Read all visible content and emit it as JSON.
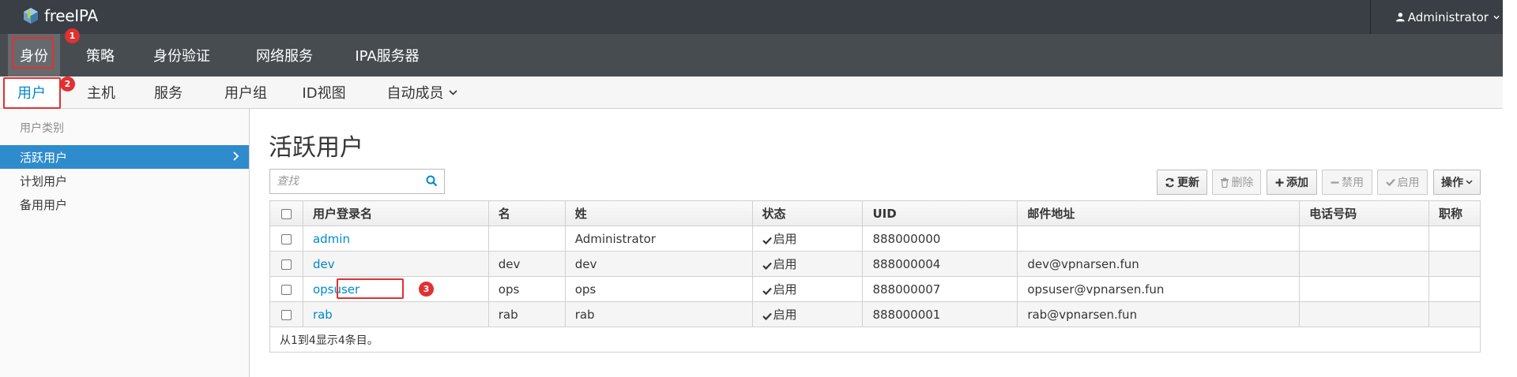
{
  "app": {
    "brand": "freeIPA",
    "user": "Administrator"
  },
  "primary_nav": [
    "身份",
    "策略",
    "身份验证",
    "网络服务",
    "IPA服务器"
  ],
  "secondary_nav": [
    "用户",
    "主机",
    "服务",
    "用户组",
    "ID视图",
    "自动成员"
  ],
  "sidebar": {
    "category": "用户类别",
    "items": [
      "活跃用户",
      "计划用户",
      "备用用户"
    ]
  },
  "page": {
    "title": "活跃用户",
    "search_placeholder": "查找"
  },
  "toolbar": {
    "refresh": "更新",
    "delete": "删除",
    "add": "添加",
    "disable": "禁用",
    "enable": "启用",
    "actions": "操作"
  },
  "table": {
    "headers": [
      "用户登录名",
      "名",
      "姓",
      "状态",
      "UID",
      "邮件地址",
      "电话号码",
      "职称"
    ],
    "rows": [
      {
        "login": "admin",
        "first": "",
        "last": "Administrator",
        "status": "启用",
        "uid": "888000000",
        "email": "",
        "phone": "",
        "title": ""
      },
      {
        "login": "dev",
        "first": "dev",
        "last": "dev",
        "status": "启用",
        "uid": "888000004",
        "email": "dev@vpnarsen.fun",
        "phone": "",
        "title": ""
      },
      {
        "login": "opsuser",
        "first": "ops",
        "last": "ops",
        "status": "启用",
        "uid": "888000007",
        "email": "opsuser@vpnarsen.fun",
        "phone": "",
        "title": ""
      },
      {
        "login": "rab",
        "first": "rab",
        "last": "rab",
        "status": "启用",
        "uid": "888000001",
        "email": "rab@vpnarsen.fun",
        "phone": "",
        "title": ""
      }
    ],
    "footer": "从1到4显示4条目。"
  },
  "annotations": [
    "1",
    "2",
    "3"
  ],
  "colors": {
    "accent": "#0088ce",
    "annotation": "#e03131",
    "sidebar_active": "#2f8ccc"
  }
}
